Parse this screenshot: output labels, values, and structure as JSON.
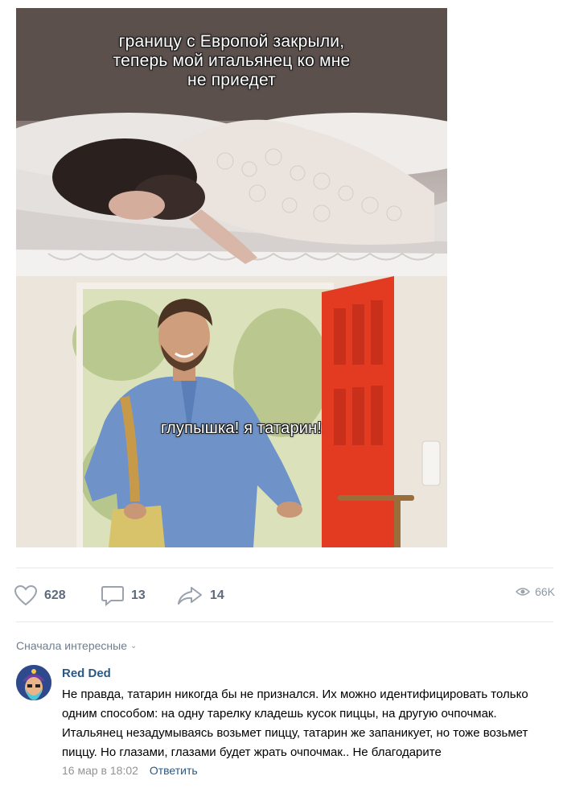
{
  "meme": {
    "caption_top": "границу с Европой закрыли,\nтеперь мой итальянец ко мне\nне приедет",
    "caption_bottom": "глупышка! я татарин!"
  },
  "post_actions": {
    "likes": "628",
    "comments": "13",
    "shares": "14",
    "views": "66K"
  },
  "comments_section": {
    "sort_label": "Сначала интересные"
  },
  "comment": {
    "author": "Red Ded",
    "text": "Не правда, татарин никогда бы не признался. Их можно идентифицировать только одним способом: на одну тарелку кладешь кусок пиццы, на другую очпочмак. Итальянец незадумываясь возьмет пиццу, татарин же запаникует, но тоже возьмет пиццу. Но глазами, глазами будет жрать очпочмак.. Не благодарите",
    "date": "16 мар в 18:02",
    "reply_label": "Ответить"
  },
  "colors": {
    "link": "#2a5885",
    "muted": "#939393",
    "icon": "#99a2ad"
  }
}
